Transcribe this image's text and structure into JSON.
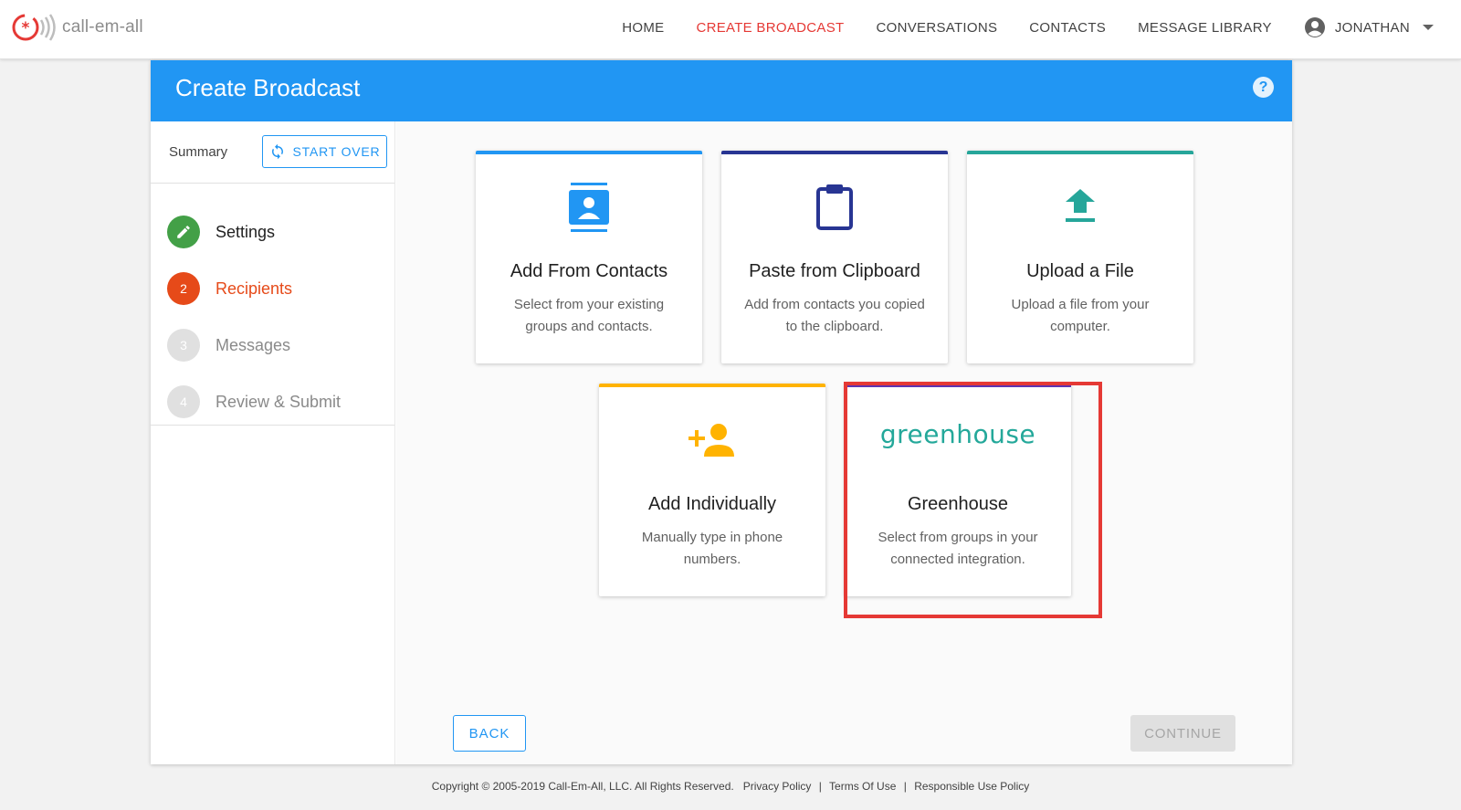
{
  "brand": {
    "name": "call-em-all",
    "logo_color": "#e53935"
  },
  "nav": {
    "items": [
      {
        "label": "HOME",
        "active": false
      },
      {
        "label": "CREATE BROADCAST",
        "active": true
      },
      {
        "label": "CONVERSATIONS",
        "active": false
      },
      {
        "label": "CONTACTS",
        "active": false
      },
      {
        "label": "MESSAGE LIBRARY",
        "active": false
      }
    ],
    "user": {
      "name": "JONATHAN",
      "icon": "account-circle-icon"
    }
  },
  "panel": {
    "title": "Create Broadcast",
    "help_icon": "?"
  },
  "sidebar": {
    "summary_label": "Summary",
    "start_over_label": "START OVER",
    "steps": [
      {
        "number": "",
        "label": "Settings",
        "state": "done",
        "icon": "pencil-icon"
      },
      {
        "number": "2",
        "label": "Recipients",
        "state": "active"
      },
      {
        "number": "3",
        "label": "Messages",
        "state": "pending"
      },
      {
        "number": "4",
        "label": "Review & Submit",
        "state": "pending"
      }
    ]
  },
  "cards": [
    {
      "title": "Add From Contacts",
      "description": "Select from your existing groups and contacts.",
      "accent": "#2196f3",
      "icon": "contacts-icon"
    },
    {
      "title": "Paste from Clipboard",
      "description": "Add from contacts you copied to the clipboard.",
      "accent": "#283593",
      "icon": "clipboard-icon"
    },
    {
      "title": "Upload a File",
      "description": "Upload a file from your computer.",
      "accent": "#26a69a",
      "icon": "upload-icon"
    },
    {
      "title": "Add Individually",
      "description": "Manually type in phone numbers.",
      "accent": "#ffb300",
      "icon": "person-add-icon"
    },
    {
      "title": "Greenhouse",
      "description": "Select from groups in your connected integration.",
      "accent": "#5e35b1",
      "icon": "greenhouse-logo",
      "logo_text": "greenhouse",
      "highlighted": true
    }
  ],
  "buttons": {
    "back": "BACK",
    "continue": "CONTINUE"
  },
  "footer": {
    "copyright": "Copyright © 2005-2019 Call-Em-All, LLC. All Rights Reserved.",
    "links": [
      "Privacy Policy",
      "Terms Of Use",
      "Responsible Use Policy"
    ]
  }
}
